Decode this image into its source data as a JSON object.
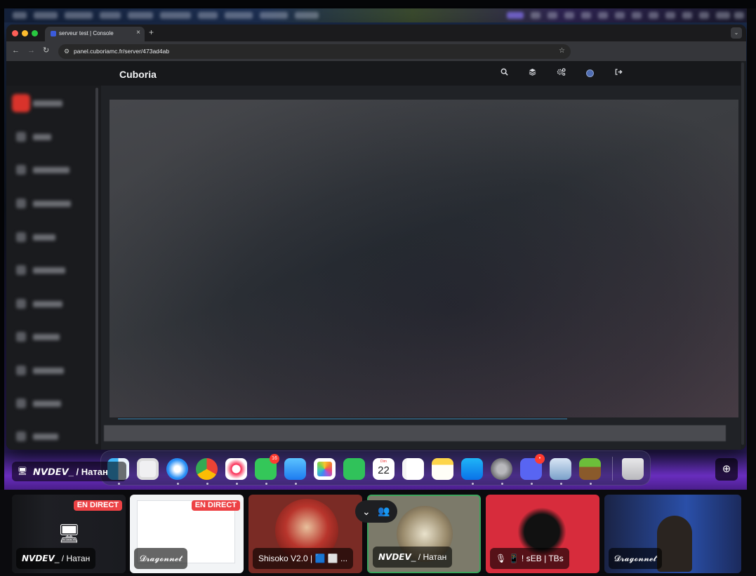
{
  "browser": {
    "tab_title": "serveur test | Console",
    "tab_close": "×",
    "new_tab": "+",
    "url": "panel.cuboriamc.fr/server/473ad4ab",
    "nav_back": "←",
    "nav_forward": "→",
    "nav_reload": "↻",
    "star": "☆",
    "dropdown": "⌄"
  },
  "app": {
    "brand": "Cuboria",
    "header_icons": [
      "search-icon",
      "layers-icon",
      "cogs-icon",
      "user-avatar",
      "sign-out-icon"
    ]
  },
  "dock": {
    "messages_badge": "16",
    "discord_badge": "•",
    "calendar_month": "Dim",
    "calendar_day": "22",
    "apps": [
      "finder",
      "launchpad",
      "safari",
      "chrome",
      "music",
      "messages",
      "mail",
      "photos",
      "facetime",
      "calendar",
      "reminders",
      "notes",
      "app-store",
      "system-settings",
      "discord",
      "disk-utility",
      "minecraft",
      "trash"
    ]
  },
  "stream": {
    "owner_icon": "🖥",
    "owner_name": "𝙉𝙑𝘿𝙀𝙑_ / Натан",
    "zoom_icon": "⊕"
  },
  "tiles": [
    {
      "label": "𝙉𝙑𝘿𝙀𝙑_ / Натан",
      "live": "EN DIRECT"
    },
    {
      "label": "𝓓𝓻𝓪𝓰𝓸𝓷𝓷𝓮𝓽",
      "live": "EN DIRECT"
    },
    {
      "label": "Shisoko V2.0 | 🟦 ⬜ ..."
    },
    {
      "label": "𝙉𝙑𝘿𝙀𝙑_ / Натан"
    },
    {
      "label": "🎙 📱 ! ꜱEB | TBꜱ"
    },
    {
      "label": "𝓓𝓻𝓪𝓰𝓸𝓷𝓷𝓮𝓽"
    }
  ],
  "tile_icons": {
    "monitor": "🖥",
    "expand_chevron": "⌄",
    "people": "👥"
  }
}
